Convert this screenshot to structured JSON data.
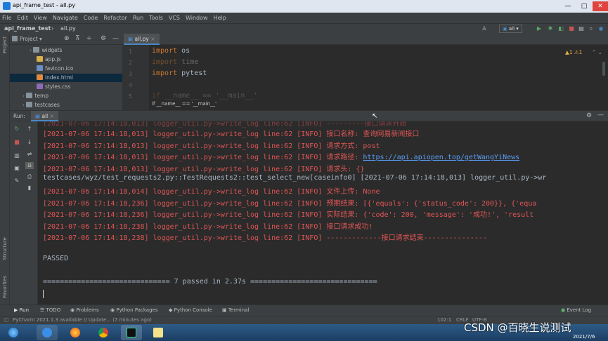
{
  "window": {
    "title": "api_frame_test - all.py",
    "minimize": "—",
    "maximize": "□",
    "close": "✕"
  },
  "menu": [
    "File",
    "Edit",
    "View",
    "Navigate",
    "Code",
    "Refactor",
    "Run",
    "Tools",
    "VCS",
    "Window",
    "Help"
  ],
  "nav": {
    "project": "api_frame_test",
    "file": "all.py",
    "run_config": "all"
  },
  "project_panel": {
    "title": "Project",
    "strip_label": "Project",
    "items": [
      {
        "label": "widgets",
        "kind": "folder"
      },
      {
        "label": "app.js",
        "kind": "js"
      },
      {
        "label": "favicon.ico",
        "kind": "ico"
      },
      {
        "label": "index.html",
        "kind": "html"
      },
      {
        "label": "styles.css",
        "kind": "css"
      },
      {
        "label": "temp",
        "kind": "folder"
      },
      {
        "label": "testcases",
        "kind": "folder"
      }
    ]
  },
  "editor": {
    "tab": "all.py",
    "inspection": "▲1 ⚠1",
    "lines": [
      {
        "n": "1",
        "kw": "import",
        "rest": " os"
      },
      {
        "n": "2",
        "kw": "import",
        "rest": " time"
      },
      {
        "n": "3",
        "kw": "import",
        "rest": " pytest"
      },
      {
        "n": "4",
        "kw": "",
        "rest": ""
      },
      {
        "n": "5",
        "kw": "if",
        "rest": " __name__ == '__main__'"
      }
    ],
    "tooltip": "if __name__ == '__main__'"
  },
  "run": {
    "label": "Run:",
    "config": "all"
  },
  "console": {
    "lines": [
      {
        "text": "[2021-07-06 17:14:18,013] logger_util.py->write_log line:62 [INFO] 接口名称: 查询网易新闻接口",
        "style": "red"
      },
      {
        "text": "[2021-07-06 17:14:18,013] logger_util.py->write_log line:62 [INFO] 请求方式: post",
        "style": "red"
      },
      {
        "text": "[2021-07-06 17:14:18,013] logger_util.py->write_log line:62 [INFO] 请求路径: ",
        "style": "red",
        "link": "https://api.apiopen.top/getWangYiNews"
      },
      {
        "text": "[2021-07-06 17:14:18,013] logger_util.py->write_log line:62 [INFO] 请求头: {}",
        "style": "red"
      },
      {
        "text": "testcases/wyz/test_requests2.py::TestRequests2::test_select_new[caseinfo0] [2021-07-06 17:14:18,013] logger_util.py->wr",
        "style": "gray"
      },
      {
        "text": "[2021-07-06 17:14:18,014] logger_util.py->write_log line:62 [INFO] 文件上传: None",
        "style": "red"
      },
      {
        "text": "[2021-07-06 17:14:18,236] logger_util.py->write_log line:62 [INFO] 预期结果: [{'equals': {'status_code': 200}}, {'equa",
        "style": "red"
      },
      {
        "text": "[2021-07-06 17:14:18,236] logger_util.py->write_log line:62 [INFO] 实际结果: {'code': 200, 'message': '成功!', 'result",
        "style": "red"
      },
      {
        "text": "[2021-07-06 17:14:18,238] logger_util.py->write_log line:62 [INFO] 接口请求成功!",
        "style": "red"
      },
      {
        "text": "[2021-07-06 17:14:18,238] logger_util.py->write_log line:62 [INFO] -------------接口请求结束---------------",
        "style": "red"
      }
    ],
    "passed": "PASSED",
    "summary": "============================== 7 passed in 2.37s =============================="
  },
  "bottom_tabs": [
    "Run",
    "TODO",
    "Problems",
    "Python Packages",
    "Python Console",
    "Terminal"
  ],
  "event_log": "Event Log",
  "status": {
    "message": "PyCharm 2021.1.3 available // Update... (7 minutes ago)",
    "position": "102:1",
    "line_sep": "CRLF",
    "encoding": "UTF-8"
  },
  "side_labels": {
    "structure": "Structure",
    "favorites": "Favorites"
  },
  "taskbar": {
    "date": "2021/7/6"
  },
  "watermark": "CSDN @百晓生说测试"
}
